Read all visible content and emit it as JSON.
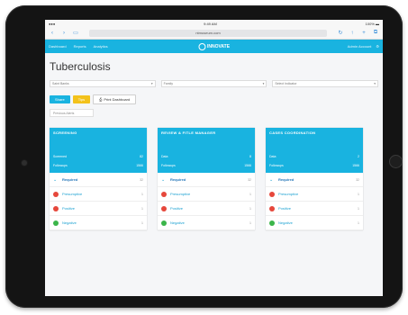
{
  "statusbar": {
    "left": "●●●",
    "time": "9:49 AM",
    "battery": "100% ▬"
  },
  "safari": {
    "url": "ntmuseum.com",
    "back_icon": "chevron-left-icon",
    "forward_icon": "chevron-right-icon"
  },
  "nav": {
    "links": [
      "Dashboard",
      "Reports",
      "Analytics"
    ],
    "logo_text": "INNOVATE",
    "user": "Admin Account"
  },
  "page": {
    "title": "Tuberculosis"
  },
  "filters": [
    {
      "value": "Saint Banks"
    },
    {
      "value": "Family"
    },
    {
      "value": "Select Indicator"
    }
  ],
  "buttons": {
    "primary": "Share",
    "secondary": "Tips",
    "print": "Print Dashboard"
  },
  "tab_chip": "Previous Alerts",
  "cards": [
    {
      "title": "SCREENING",
      "row1_label": "Screened",
      "row1_value": "82",
      "row2_label": "Followups",
      "row2_value": "1566",
      "rows": [
        {
          "label": "Required",
          "count": "32",
          "type": "chev"
        },
        {
          "label": "Presumptive",
          "count": "1",
          "type": "red"
        },
        {
          "label": "Positive",
          "count": "1",
          "type": "red"
        },
        {
          "label": "Negative",
          "count": "1",
          "type": "green"
        }
      ]
    },
    {
      "title": "REVIEW & FITLE MANAGER",
      "row1_label": "Data",
      "row1_value": "8",
      "row2_label": "Followups",
      "row2_value": "1566",
      "rows": [
        {
          "label": "Required",
          "count": "32",
          "type": "chev"
        },
        {
          "label": "Presumptive",
          "count": "1",
          "type": "red"
        },
        {
          "label": "Positive",
          "count": "1",
          "type": "red"
        },
        {
          "label": "Negative",
          "count": "1",
          "type": "green"
        }
      ]
    },
    {
      "title": "CASES COORDINATION",
      "row1_label": "Data",
      "row1_value": "2",
      "row2_label": "Followups",
      "row2_value": "1566",
      "rows": [
        {
          "label": "Required",
          "count": "32",
          "type": "chev"
        },
        {
          "label": "Presumptive",
          "count": "1",
          "type": "red"
        },
        {
          "label": "Positive",
          "count": "1",
          "type": "red"
        },
        {
          "label": "Negative",
          "count": "1",
          "type": "green"
        }
      ]
    }
  ],
  "colors": {
    "primary": "#19b3e0",
    "yellow": "#f3c21b",
    "red": "#e6473b",
    "green": "#3bb54a",
    "bezel": "#141414"
  }
}
